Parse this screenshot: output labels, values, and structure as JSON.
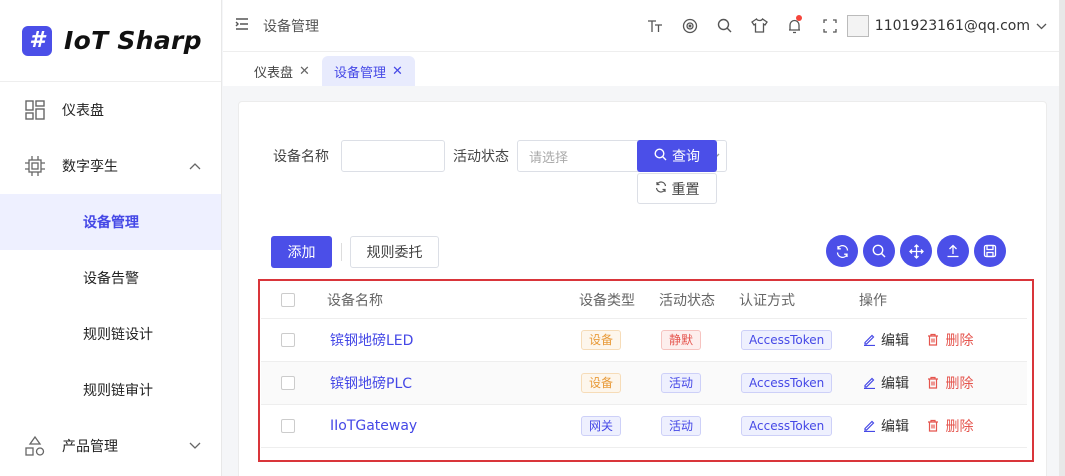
{
  "app": {
    "logo_glyph": "#",
    "name": "IoT Sharp"
  },
  "sidebar": {
    "items": [
      {
        "label": "仪表盘",
        "icon": "dashboard-icon"
      },
      {
        "label": "数字孪生",
        "icon": "chip-icon",
        "expanded": true
      },
      {
        "label": "设备管理",
        "active": true,
        "sub": true
      },
      {
        "label": "设备告警",
        "sub": true
      },
      {
        "label": "规则链设计",
        "sub": true
      },
      {
        "label": "规则链审计",
        "sub": true
      },
      {
        "label": "产品管理",
        "icon": "shapes-icon"
      }
    ]
  },
  "header": {
    "breadcrumb": "设备管理",
    "user_email": "1101923161@qq.com",
    "tools": [
      "font-size-icon",
      "target-icon",
      "search-icon",
      "shirt-icon",
      "bell-icon",
      "fullscreen-icon"
    ]
  },
  "tabs": [
    {
      "label": "仪表盘",
      "active": false
    },
    {
      "label": "设备管理",
      "active": true
    }
  ],
  "search": {
    "device_name_label": "设备名称",
    "device_name_value": "",
    "status_label": "活动状态",
    "status_placeholder": "请选择",
    "query_label": "查询",
    "reset_label": "重置"
  },
  "toolbar": {
    "add_label": "添加",
    "rule_label": "规则委托",
    "icons": [
      "refresh-icon",
      "search-icon",
      "move-icon",
      "upload-icon",
      "save-icon"
    ]
  },
  "table": {
    "columns": [
      "设备名称",
      "设备类型",
      "活动状态",
      "认证方式",
      "操作"
    ],
    "rows": [
      {
        "name": "镔钢地磅LED",
        "type": "设备",
        "status": "静默",
        "auth": "AccessToken"
      },
      {
        "name": "镔钢地磅PLC",
        "type": "设备",
        "status": "活动",
        "auth": "AccessToken"
      },
      {
        "name": "IIoTGateway",
        "type": "网关",
        "status": "活动",
        "auth": "AccessToken"
      }
    ],
    "edit_label": "编辑",
    "delete_label": "删除"
  },
  "colors": {
    "accent": "#4b4fe8",
    "danger": "#e5554e",
    "highlight": "#d9353a"
  }
}
